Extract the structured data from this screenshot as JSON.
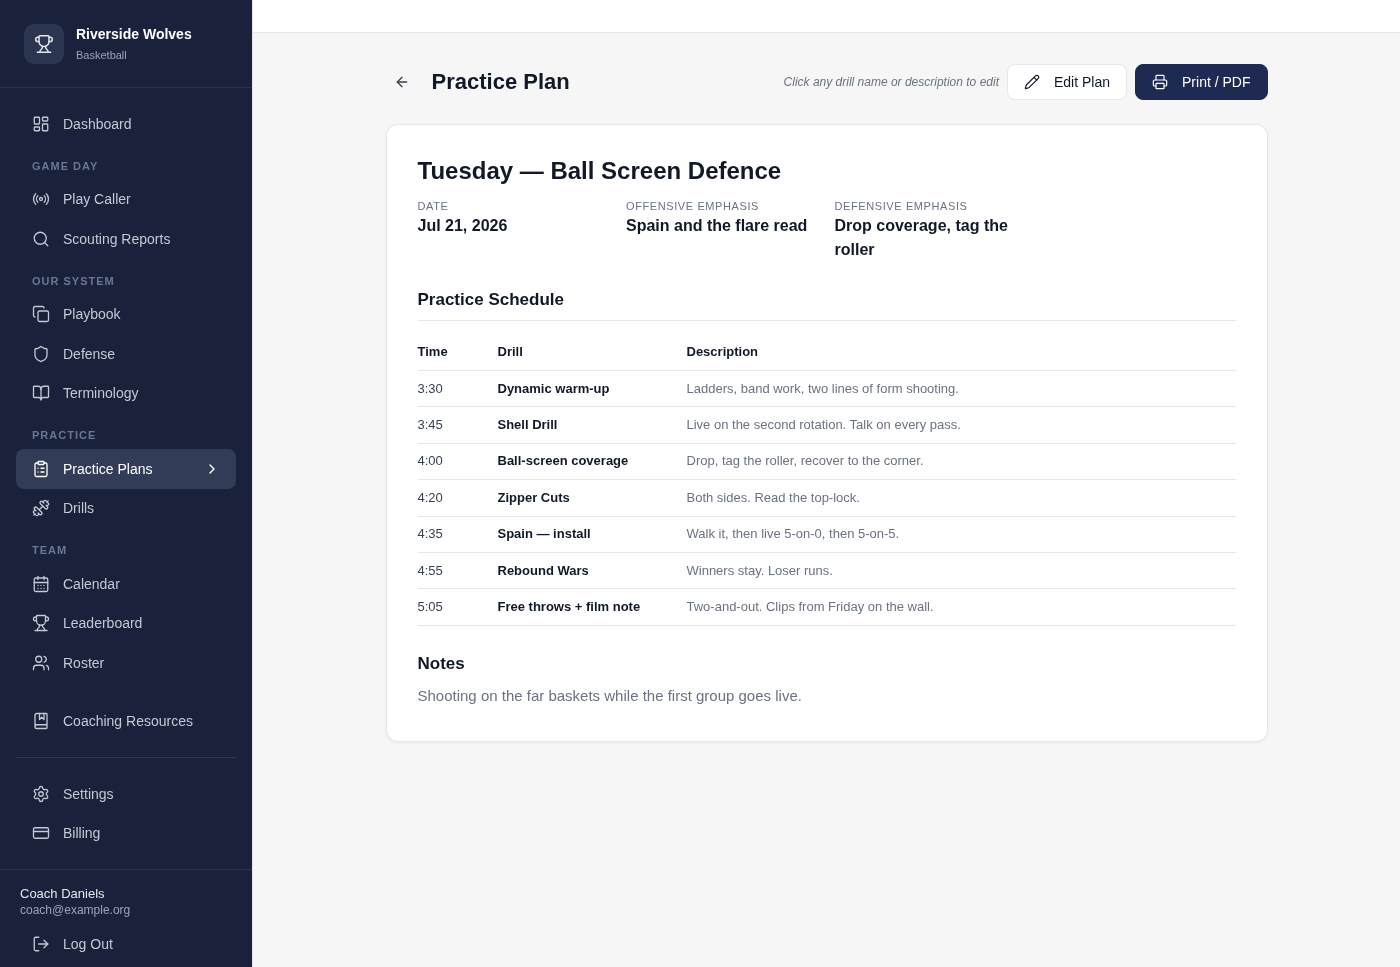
{
  "sidebar": {
    "brand": {
      "name": "Riverside Wolves",
      "subtitle": "Basketball"
    },
    "groups": [
      {
        "items": [
          {
            "label": "Dashboard",
            "selected": false
          }
        ]
      },
      {
        "heading": "GAME DAY",
        "items": [
          {
            "label": "Play Caller",
            "selected": false
          },
          {
            "label": "Scouting Reports",
            "selected": false
          }
        ]
      },
      {
        "heading": "OUR SYSTEM",
        "items": [
          {
            "label": "Playbook",
            "selected": false
          },
          {
            "label": "Defense",
            "selected": false
          },
          {
            "label": "Terminology",
            "selected": false
          }
        ]
      },
      {
        "heading": "PRACTICE",
        "items": [
          {
            "label": "Practice Plans",
            "selected": true
          },
          {
            "label": "Drills",
            "selected": false
          }
        ]
      },
      {
        "heading": "TEAM",
        "items": [
          {
            "label": "Calendar",
            "selected": false
          },
          {
            "label": "Leaderboard",
            "selected": false
          },
          {
            "label": "Roster",
            "selected": false
          }
        ]
      },
      {
        "items": [
          {
            "label": "Coaching Resources",
            "selected": false
          }
        ]
      }
    ],
    "bottom_items": [
      {
        "label": "Settings",
        "selected": false
      },
      {
        "label": "Billing",
        "selected": false
      }
    ],
    "user": {
      "name": "Coach Daniels",
      "email": "coach@example.org"
    },
    "logout": "Log Out"
  },
  "header": {
    "title": "Practice Plan",
    "hint": "Click any drill name or description to edit",
    "actions": [
      {
        "label": "Edit Plan",
        "kind": "secondary"
      },
      {
        "label": "Print / PDF",
        "kind": "primary"
      }
    ]
  },
  "plan": {
    "title": "Tuesday — Ball Screen Defence",
    "meta": [
      {
        "label": "DATE",
        "value": "Jul 21, 2026"
      },
      {
        "label": "OFFENSIVE EMPHASIS",
        "value": "Spain and the flare read"
      },
      {
        "label": "DEFENSIVE EMPHASIS",
        "value": "Drop coverage, tag the roller"
      }
    ],
    "schedule": {
      "title": "Practice Schedule",
      "columns": [
        "Time",
        "Drill",
        "Description"
      ],
      "rows": [
        {
          "time": "3:30",
          "drill": "Dynamic warm-up",
          "description": "Ladders, band work, two lines of form shooting."
        },
        {
          "time": "3:45",
          "drill": "Shell Drill",
          "description": "Live on the second rotation. Talk on every pass."
        },
        {
          "time": "4:00",
          "drill": "Ball-screen coverage",
          "description": "Drop, tag the roller, recover to the corner."
        },
        {
          "time": "4:20",
          "drill": "Zipper Cuts",
          "description": "Both sides. Read the top-lock."
        },
        {
          "time": "4:35",
          "drill": "Spain — install",
          "description": "Walk it, then live 5-on-0, then 5-on-5."
        },
        {
          "time": "4:55",
          "drill": "Rebound Wars",
          "description": "Winners stay. Loser runs."
        },
        {
          "time": "5:05",
          "drill": "Free throws + film note",
          "description": "Two-and-out. Clips from Friday on the wall."
        }
      ]
    },
    "notes": {
      "title": "Notes",
      "text": "Shooting on the far baskets while the first group goes live."
    }
  }
}
